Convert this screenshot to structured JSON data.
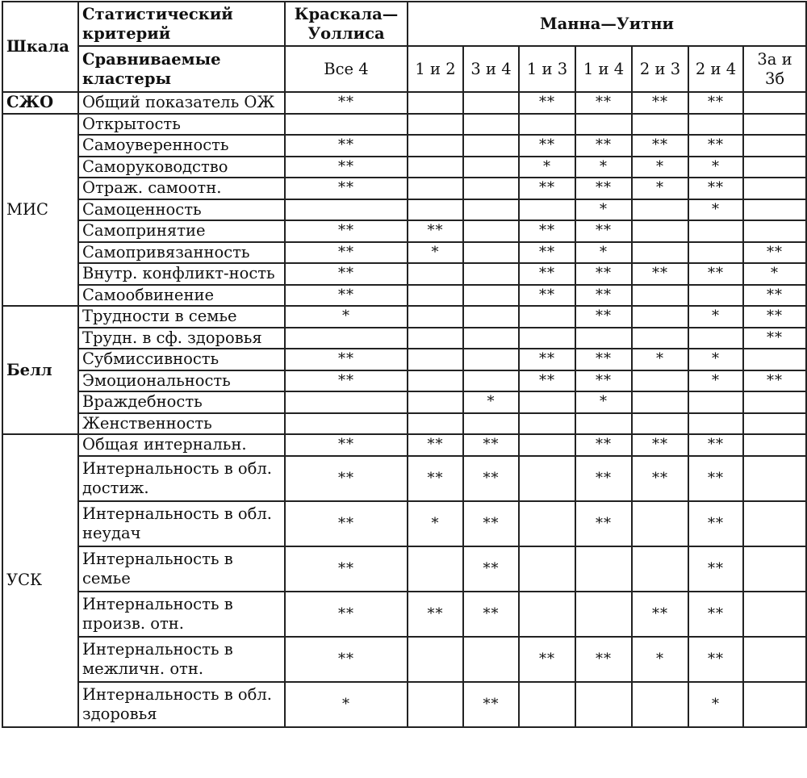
{
  "header": {
    "scale_label": "Шкала",
    "criterion_label": "Статистический критерий",
    "clusters_label": "Сравниваемые кластеры",
    "kruskal_label": "Краскала—Уоллиса",
    "mann_label": "Манна—Уитни",
    "comparisons": [
      "Все 4",
      "1 и 2",
      "3 и 4",
      "1 и 3",
      "1 и 4",
      "2 и 3",
      "2 и 4",
      "3а и 3б"
    ]
  },
  "groups": [
    {
      "scale": "СЖО",
      "bold": true,
      "rows": [
        {
          "name": "Общий показатель ОЖ",
          "marks": [
            "**",
            "",
            "",
            "**",
            "**",
            "**",
            "**",
            ""
          ]
        }
      ]
    },
    {
      "scale": "МИС",
      "bold": false,
      "rows": [
        {
          "name": "Открытость",
          "marks": [
            "",
            "",
            "",
            "",
            "",
            "",
            "",
            ""
          ]
        },
        {
          "name": "Самоуверенность",
          "marks": [
            "**",
            "",
            "",
            "**",
            "**",
            "**",
            "**",
            ""
          ]
        },
        {
          "name": "Саморуководство",
          "marks": [
            "**",
            "",
            "",
            "*",
            "*",
            "*",
            "*",
            ""
          ]
        },
        {
          "name": "Отраж. самоотн.",
          "marks": [
            "**",
            "",
            "",
            "**",
            "**",
            "*",
            "**",
            ""
          ]
        },
        {
          "name": "Самоценность",
          "marks": [
            "",
            "",
            "",
            "",
            "*",
            "",
            "*",
            ""
          ]
        },
        {
          "name": "Самопринятие",
          "marks": [
            "**",
            "**",
            "",
            "**",
            "**",
            "",
            "",
            ""
          ]
        },
        {
          "name": "Самопривязанность",
          "marks": [
            "**",
            "*",
            "",
            "**",
            "*",
            "",
            "",
            "**"
          ]
        },
        {
          "name": "Внутр. конфликт-ность",
          "marks": [
            "**",
            "",
            "",
            "**",
            "**",
            "**",
            "**",
            "*"
          ]
        },
        {
          "name": "Самообвинение",
          "marks": [
            "**",
            "",
            "",
            "**",
            "**",
            "",
            "",
            "**"
          ]
        }
      ]
    },
    {
      "scale": "Белл",
      "bold": true,
      "rows": [
        {
          "name": "Трудности в семье",
          "marks": [
            "*",
            "",
            "",
            "",
            "**",
            "",
            "*",
            "**"
          ]
        },
        {
          "name": "Трудн. в сф. здоровья",
          "marks": [
            "",
            "",
            "",
            "",
            "",
            "",
            "",
            "**"
          ]
        },
        {
          "name": "Субмиссивность",
          "marks": [
            "**",
            "",
            "",
            "**",
            "**",
            "*",
            "*",
            ""
          ]
        },
        {
          "name": "Эмоциональность",
          "marks": [
            "**",
            "",
            "",
            "**",
            "**",
            "",
            "*",
            "**"
          ]
        },
        {
          "name": "Враждебность",
          "marks": [
            "",
            "",
            "*",
            "",
            "*",
            "",
            "",
            ""
          ]
        },
        {
          "name": "Женственность",
          "marks": [
            "",
            "",
            "",
            "",
            "",
            "",
            "",
            ""
          ]
        }
      ]
    },
    {
      "scale": "УСК",
      "bold": false,
      "rows": [
        {
          "name": "Общая интернальн.",
          "marks": [
            "**",
            "**",
            "**",
            "",
            "**",
            "**",
            "**",
            ""
          ]
        },
        {
          "name": "Интернальность в обл. достиж.",
          "marks": [
            "**",
            "**",
            "**",
            "",
            "**",
            "**",
            "**",
            ""
          ]
        },
        {
          "name": "Интернальность в обл. неудач",
          "marks": [
            "**",
            "*",
            "**",
            "",
            "**",
            "",
            "**",
            ""
          ]
        },
        {
          "name": "Интернальность в семье",
          "marks": [
            "**",
            "",
            "**",
            "",
            "",
            "",
            "**",
            ""
          ]
        },
        {
          "name": "Интернальность в произв. отн.",
          "marks": [
            "**",
            "**",
            "**",
            "",
            "",
            "**",
            "**",
            ""
          ]
        },
        {
          "name": "Интернальность в межличн. отн.",
          "marks": [
            "**",
            "",
            "",
            "**",
            "**",
            "*",
            "**",
            ""
          ]
        },
        {
          "name": "Интернальность в обл. здоровья",
          "marks": [
            "*",
            "",
            "**",
            "",
            "",
            "",
            "*",
            ""
          ]
        }
      ]
    }
  ]
}
